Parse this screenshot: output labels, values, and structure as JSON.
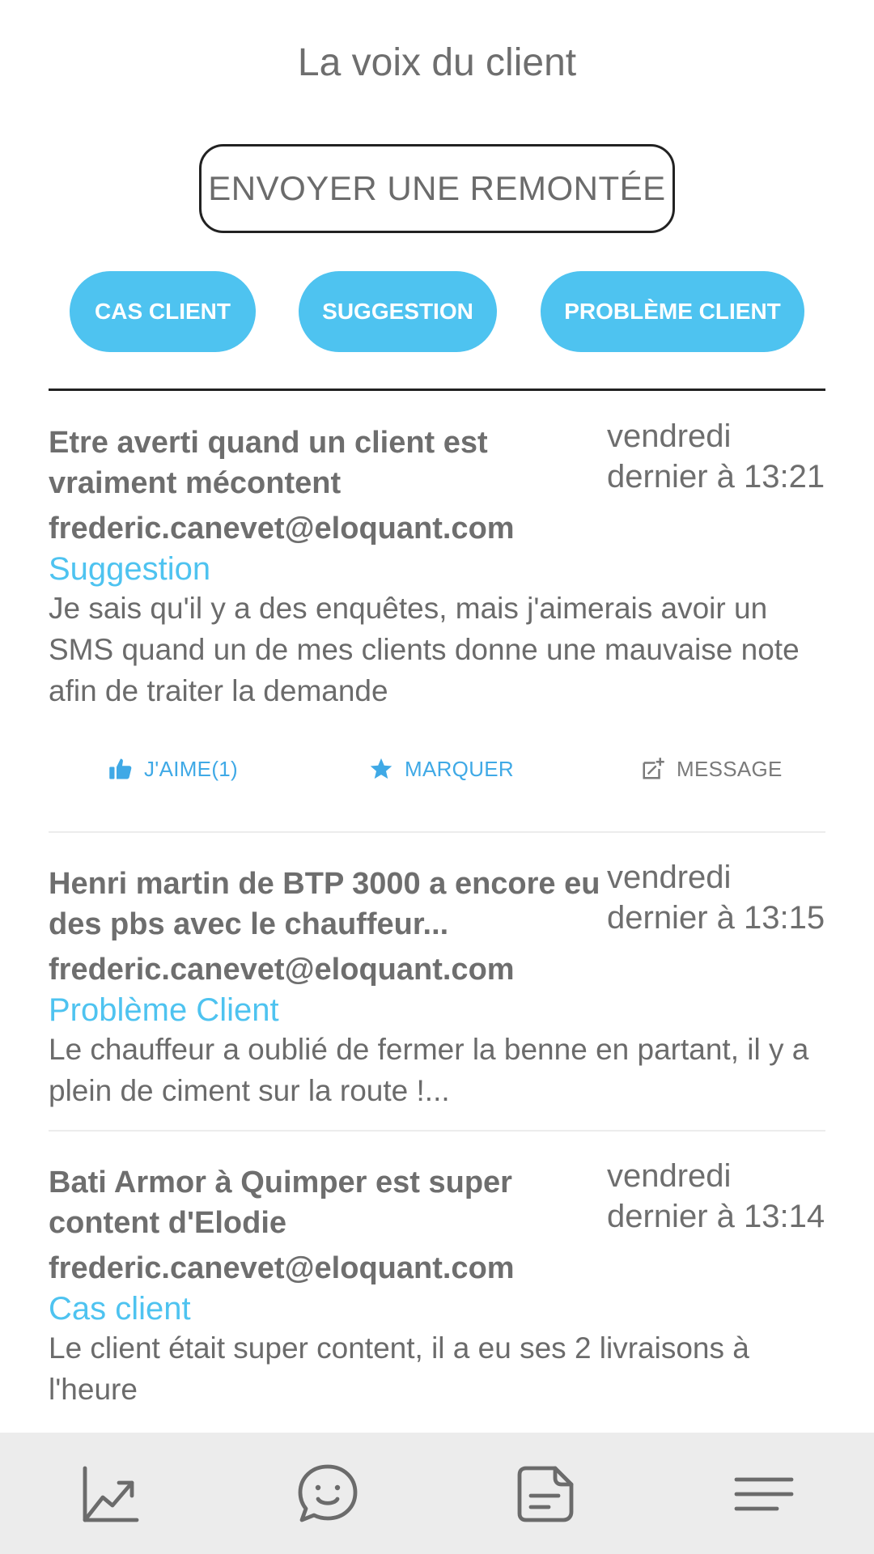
{
  "header": {
    "title": "La voix du client"
  },
  "send_button": {
    "label": "ENVOYER UNE REMONTÉE"
  },
  "filters": [
    {
      "label": "CAS CLIENT"
    },
    {
      "label": "SUGGESTION"
    },
    {
      "label": "PROBLÈME CLIENT"
    }
  ],
  "feed": [
    {
      "title": "Etre averti quand un client est vraiment mécontent",
      "date": "vendredi dernier à 13:21",
      "email": "frederic.canevet@eloquant.com",
      "category": "Suggestion",
      "body": "Je sais qu'il y a des enquêtes, mais j'aimerais avoir un SMS quand un de mes clients donne une mauvaise note afin de traiter la demande",
      "actions": {
        "like": "J'AIME(1)",
        "mark": "MARQUER",
        "message": "MESSAGE"
      }
    },
    {
      "title": "Henri martin de BTP 3000 a encore eu des pbs avec le chauffeur...",
      "date": "vendredi dernier à 13:15",
      "email": "frederic.canevet@eloquant.com",
      "category": "Problème Client",
      "body": "Le chauffeur a oublié de fermer la benne en partant, il y a plein de ciment sur la route !..."
    },
    {
      "title": "Bati Armor à Quimper est super content d'Elodie",
      "date": "vendredi dernier à 13:14",
      "email": "frederic.canevet@eloquant.com",
      "category": "Cas client",
      "body": "Le client était super content, il a eu ses 2 livraisons à l'heure"
    }
  ],
  "bottom_nav": [
    {
      "icon": "chart-trend-icon"
    },
    {
      "icon": "chat-smile-icon"
    },
    {
      "icon": "note-icon"
    },
    {
      "icon": "menu-icon"
    }
  ],
  "colors": {
    "accent": "#4ec3f0",
    "link": "#3fa9e6",
    "text": "#6b6b6b",
    "nav_bg": "#ececec"
  }
}
